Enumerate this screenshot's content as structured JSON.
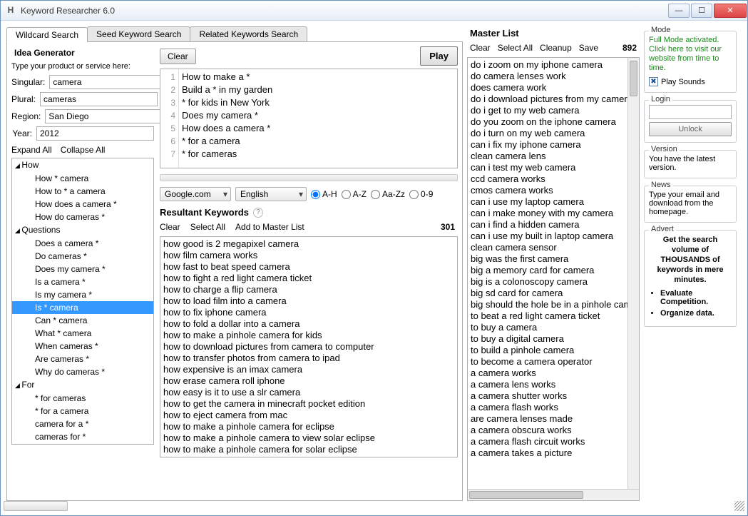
{
  "window": {
    "title": "Keyword Researcher 6.0",
    "icon": "H"
  },
  "tabs": {
    "wildcard": "Wildcard Search",
    "seed": "Seed Keyword Search",
    "related": "Related Keywords Search"
  },
  "ideagen": {
    "title": "Idea Generator",
    "hint": "Type your product or service here:",
    "labels": {
      "singular": "Singular:",
      "plural": "Plural:",
      "region": "Region:",
      "year": "Year:"
    },
    "values": {
      "singular": "camera",
      "plural": "cameras",
      "region": "San Diego",
      "year": "2012"
    },
    "expand": "Expand All",
    "collapse": "Collapse All"
  },
  "tree": [
    {
      "t": "root",
      "label": "How"
    },
    {
      "t": "child",
      "label": "How * camera"
    },
    {
      "t": "child",
      "label": "How to * a camera"
    },
    {
      "t": "child",
      "label": "How does a camera *"
    },
    {
      "t": "child",
      "label": "How do cameras *"
    },
    {
      "t": "root",
      "label": "Questions"
    },
    {
      "t": "child",
      "label": "Does a camera *"
    },
    {
      "t": "child",
      "label": "Do cameras *"
    },
    {
      "t": "child",
      "label": "Does my camera *"
    },
    {
      "t": "child",
      "label": "Is a camera *"
    },
    {
      "t": "child",
      "label": "Is my camera *"
    },
    {
      "t": "child",
      "label": "Is * camera",
      "sel": true
    },
    {
      "t": "child",
      "label": "Can * camera"
    },
    {
      "t": "child",
      "label": "What * camera"
    },
    {
      "t": "child",
      "label": "When cameras *"
    },
    {
      "t": "child",
      "label": "Are cameras *"
    },
    {
      "t": "child",
      "label": "Why do cameras *"
    },
    {
      "t": "root",
      "label": "For"
    },
    {
      "t": "child",
      "label": "* for cameras"
    },
    {
      "t": "child",
      "label": "* for a camera"
    },
    {
      "t": "child",
      "label": "camera for a *"
    },
    {
      "t": "child",
      "label": "cameras for *"
    }
  ],
  "seed": {
    "clear": "Clear",
    "play": "Play",
    "lines": [
      "How to make a *",
      "Build a * in my garden",
      "* for kids in New York",
      "Does my camera *",
      "How does a camera *",
      "* for a camera",
      "* for cameras"
    ]
  },
  "controls": {
    "engine": "Google.com",
    "lang": "English",
    "radios": {
      "ah": "A-H",
      "az": "A-Z",
      "aazz": "Aa-Zz",
      "n09": "0-9"
    }
  },
  "resultant": {
    "title": "Resultant Keywords",
    "clear": "Clear",
    "selectall": "Select All",
    "add": "Add to Master List",
    "count": "301",
    "items": [
      "how good is 2 megapixel camera",
      "how film camera works",
      "how fast to beat speed camera",
      "how to fight a red light camera ticket",
      "how to charge a flip camera",
      "how to load film into a camera",
      "how to fix iphone camera",
      "how to fold a dollar into a camera",
      "how to make a pinhole camera for kids",
      "how to download pictures from camera to computer",
      "how to transfer photos from camera to ipad",
      "how expensive is an imax camera",
      "how erase camera roll iphone",
      "how easy is it to use a slr camera",
      "how to get the camera in minecraft pocket edition",
      "how to eject camera from mac",
      "how to make a pinhole camera for eclipse",
      "how to make a pinhole camera to view solar eclipse",
      "how to make a pinhole camera for solar eclipse"
    ]
  },
  "master": {
    "title": "Master List",
    "clear": "Clear",
    "selectall": "Select All",
    "cleanup": "Cleanup",
    "save": "Save",
    "count": "892",
    "items": [
      "do i zoom on my iphone camera",
      "do camera lenses work",
      "does camera work",
      "do i download pictures from my camera",
      "do i get to my web camera",
      "do you zoom on the iphone camera",
      "do i turn on my web camera",
      "can i fix my iphone camera",
      "clean camera lens",
      "can i test my web camera",
      "ccd camera works",
      "cmos camera works",
      "can i use my laptop camera",
      "can i make money with my camera",
      "can i find a hidden camera",
      "can i use my built in laptop camera",
      "clean camera sensor",
      "big was the first camera",
      "big a memory card for camera",
      "big is a colonoscopy camera",
      "big sd card for camera",
      "big should the hole be in a pinhole camera",
      "to beat a red light camera ticket",
      "to buy a camera",
      "to buy a digital camera",
      "to build a pinhole camera",
      "to become a camera operator",
      "a camera works",
      "a camera lens works",
      "a camera shutter works",
      "a camera flash works",
      "are camera lenses made",
      "a camera obscura works",
      "a camera flash circuit works",
      "a camera takes a picture"
    ]
  },
  "right": {
    "mode": {
      "legend": "Mode",
      "text": "Full Mode activated. Click here to visit our website from time to time.",
      "play_sounds": "Play Sounds"
    },
    "login": {
      "legend": "Login",
      "unlock": "Unlock"
    },
    "version": {
      "legend": "Version",
      "text": "You have the latest version."
    },
    "news": {
      "legend": "News",
      "text": "Type your email and download from the homepage."
    },
    "advert": {
      "legend": "Advert",
      "head": "Get the search volume of THOUSANDS of keywords in mere minutes.",
      "b1": "Evaluate Competition.",
      "b2": "Organize data."
    }
  }
}
